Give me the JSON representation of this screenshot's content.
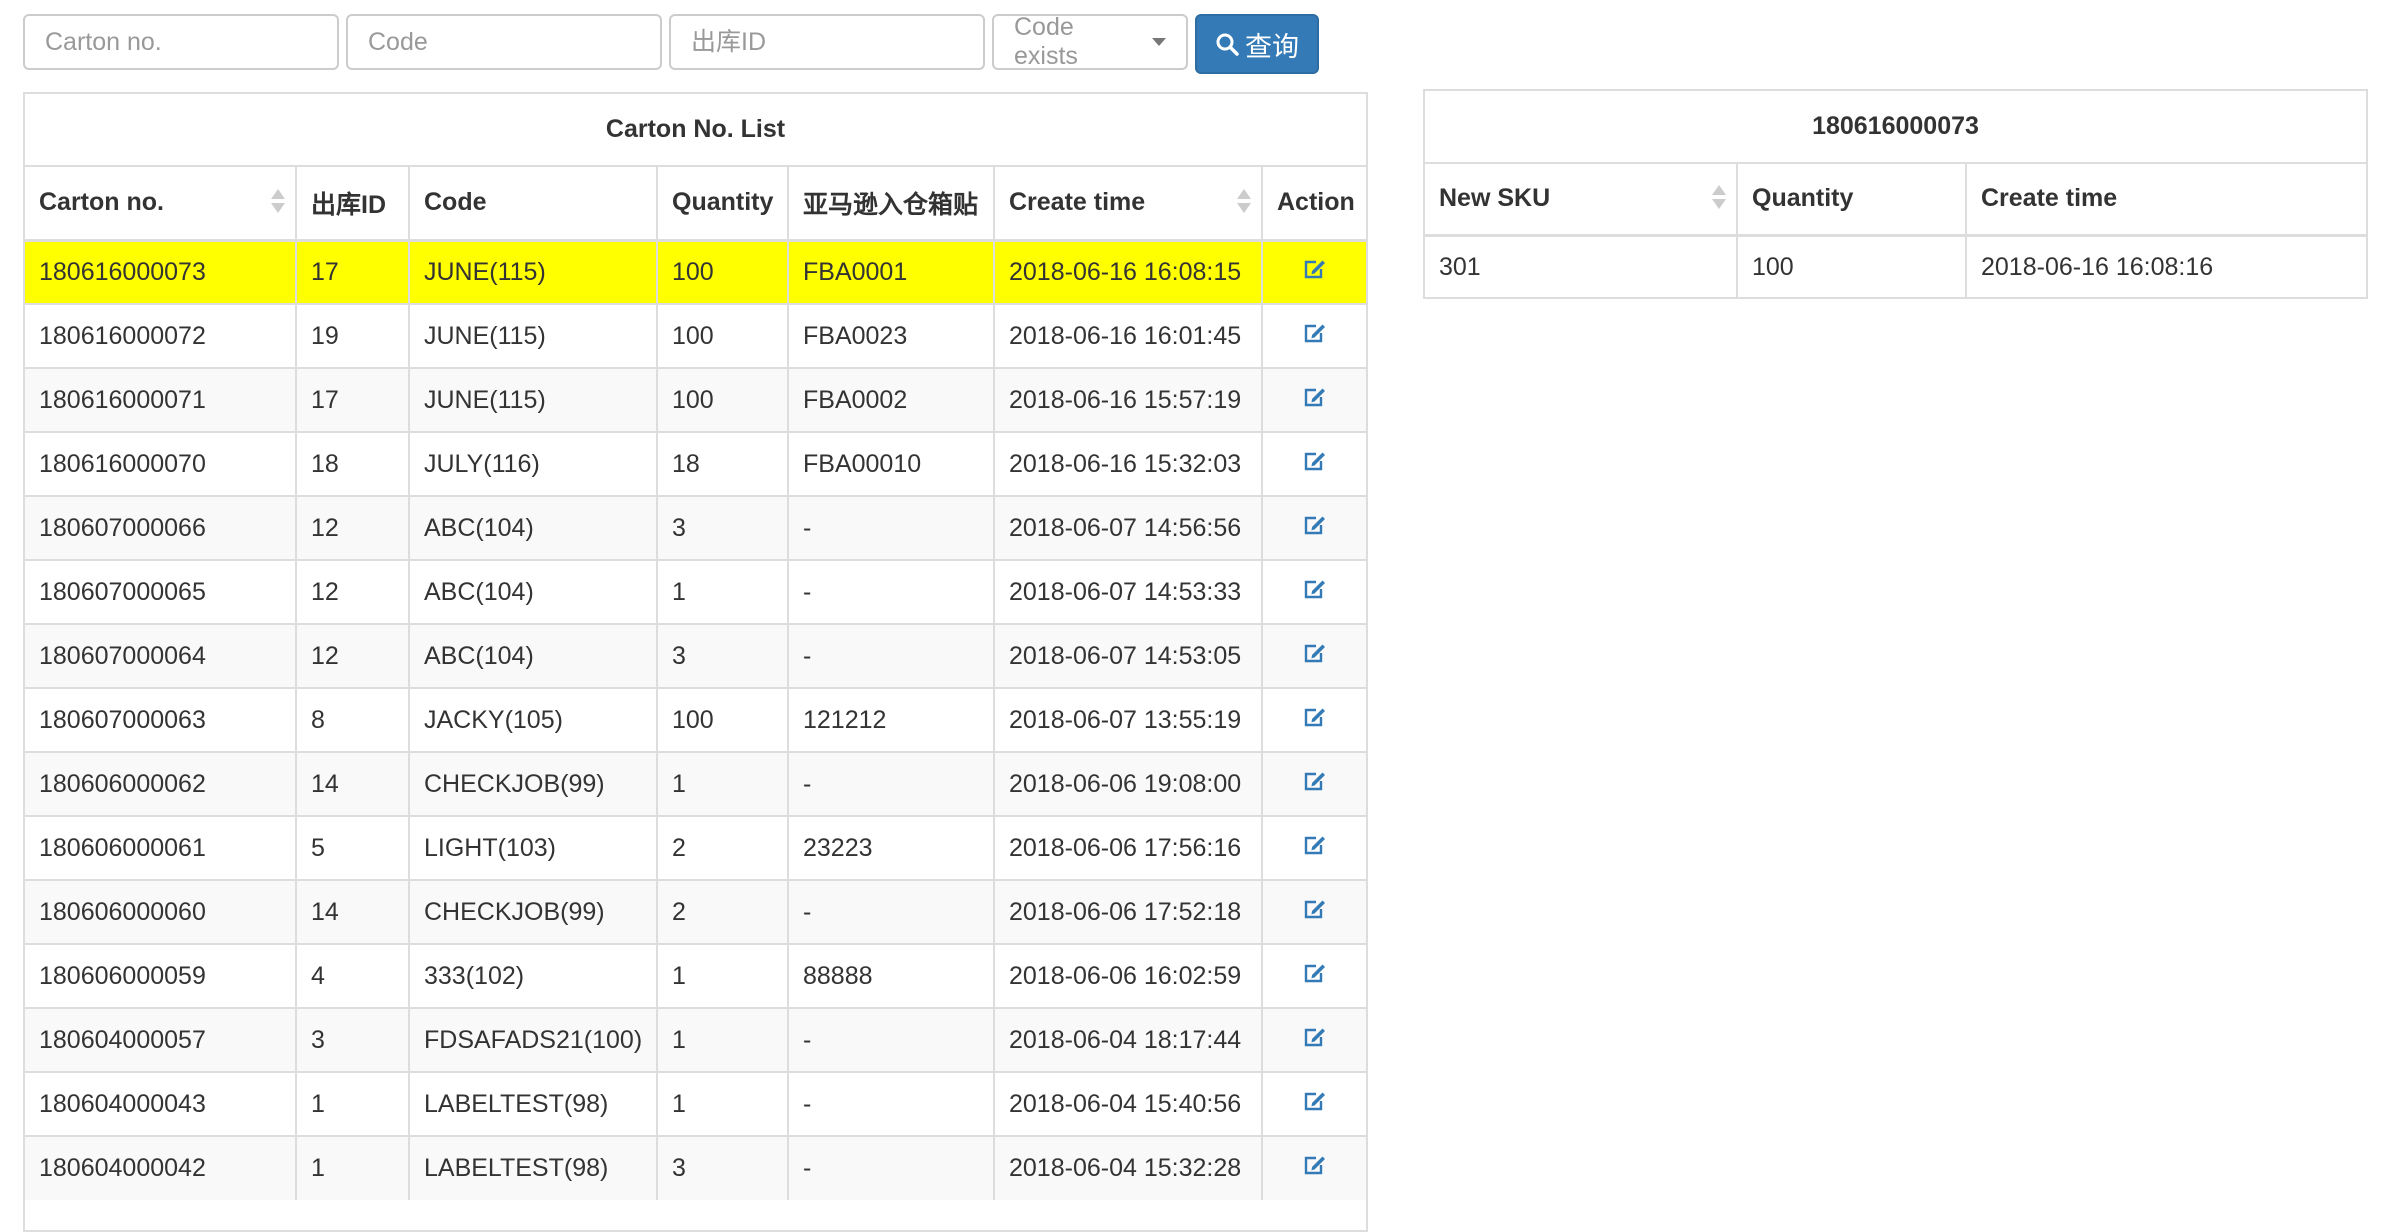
{
  "search": {
    "carton_placeholder": "Carton no.",
    "code_placeholder": "Code",
    "outbound_placeholder": "出库ID",
    "code_exists_label": "Code exists",
    "search_button_label": "查询",
    "search_icon": "search-icon"
  },
  "carton_list": {
    "title": "Carton No. List",
    "headers": {
      "carton_no": "Carton no.",
      "outbound_id": "出库ID",
      "code": "Code",
      "quantity": "Quantity",
      "amazon_label": "亚马逊入仓箱贴",
      "create_time": "Create time",
      "action": "Action"
    },
    "action_icon": "edit-icon",
    "selected_row_color": "#ffff00",
    "rows": [
      {
        "carton_no": "180616000073",
        "outbound_id": "17",
        "code": "JUNE(115)",
        "quantity": "100",
        "amazon_label": "FBA0001",
        "create_time": "2018-06-16 16:08:15"
      },
      {
        "carton_no": "180616000072",
        "outbound_id": "19",
        "code": "JUNE(115)",
        "quantity": "100",
        "amazon_label": "FBA0023",
        "create_time": "2018-06-16 16:01:45"
      },
      {
        "carton_no": "180616000071",
        "outbound_id": "17",
        "code": "JUNE(115)",
        "quantity": "100",
        "amazon_label": "FBA0002",
        "create_time": "2018-06-16 15:57:19"
      },
      {
        "carton_no": "180616000070",
        "outbound_id": "18",
        "code": "JULY(116)",
        "quantity": "18",
        "amazon_label": "FBA00010",
        "create_time": "2018-06-16 15:32:03"
      },
      {
        "carton_no": "180607000066",
        "outbound_id": "12",
        "code": "ABC(104)",
        "quantity": "3",
        "amazon_label": "-",
        "create_time": "2018-06-07 14:56:56"
      },
      {
        "carton_no": "180607000065",
        "outbound_id": "12",
        "code": "ABC(104)",
        "quantity": "1",
        "amazon_label": "-",
        "create_time": "2018-06-07 14:53:33"
      },
      {
        "carton_no": "180607000064",
        "outbound_id": "12",
        "code": "ABC(104)",
        "quantity": "3",
        "amazon_label": "-",
        "create_time": "2018-06-07 14:53:05"
      },
      {
        "carton_no": "180607000063",
        "outbound_id": "8",
        "code": "JACKY(105)",
        "quantity": "100",
        "amazon_label": "121212",
        "create_time": "2018-06-07 13:55:19"
      },
      {
        "carton_no": "180606000062",
        "outbound_id": "14",
        "code": "CHECKJOB(99)",
        "quantity": "1",
        "amazon_label": "-",
        "create_time": "2018-06-06 19:08:00"
      },
      {
        "carton_no": "180606000061",
        "outbound_id": "5",
        "code": "LIGHT(103)",
        "quantity": "2",
        "amazon_label": "23223",
        "create_time": "2018-06-06 17:56:16"
      },
      {
        "carton_no": "180606000060",
        "outbound_id": "14",
        "code": "CHECKJOB(99)",
        "quantity": "2",
        "amazon_label": "-",
        "create_time": "2018-06-06 17:52:18"
      },
      {
        "carton_no": "180606000059",
        "outbound_id": "4",
        "code": "333(102)",
        "quantity": "1",
        "amazon_label": "88888",
        "create_time": "2018-06-06 16:02:59"
      },
      {
        "carton_no": "180604000057",
        "outbound_id": "3",
        "code": "FDSAFADS21(100)",
        "quantity": "1",
        "amazon_label": "-",
        "create_time": "2018-06-04 18:17:44"
      },
      {
        "carton_no": "180604000043",
        "outbound_id": "1",
        "code": "LABELTEST(98)",
        "quantity": "1",
        "amazon_label": "-",
        "create_time": "2018-06-04 15:40:56"
      },
      {
        "carton_no": "180604000042",
        "outbound_id": "1",
        "code": "LABELTEST(98)",
        "quantity": "3",
        "amazon_label": "-",
        "create_time": "2018-06-04 15:32:28"
      }
    ]
  },
  "detail": {
    "title": "180616000073",
    "headers": {
      "new_sku": "New SKU",
      "quantity": "Quantity",
      "create_time": "Create time"
    },
    "rows": [
      {
        "new_sku": "301",
        "quantity": "100",
        "create_time": "2018-06-16 16:08:16"
      }
    ]
  },
  "colors": {
    "primary_button": "#337ab7",
    "border": "#dddddd",
    "stripe": "#f9f9f9",
    "highlight": "#ffff00"
  }
}
